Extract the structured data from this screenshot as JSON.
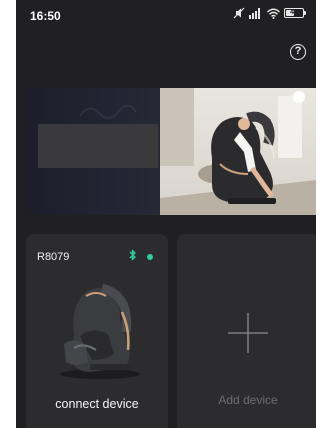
{
  "status_bar": {
    "time": "16:50",
    "battery_level": "47",
    "icons": [
      "mute-icon",
      "signal-icon",
      "wifi-icon",
      "battery-icon"
    ]
  },
  "header": {
    "help_icon": "question-icon",
    "help_glyph": "?"
  },
  "banner": {
    "image": "massage-chair-banner"
  },
  "devices": [
    {
      "model": "R8079",
      "bluetooth_icon": "bluetooth-icon",
      "status_color": "#2ecf9a",
      "action_label": "connect device"
    }
  ],
  "add_device": {
    "label": "Add device",
    "icon": "plus-icon"
  },
  "colors": {
    "background": "#202022",
    "card": "#2c2c2f",
    "accent": "#2ecf9a",
    "bluetooth": "#2ecf9a"
  }
}
